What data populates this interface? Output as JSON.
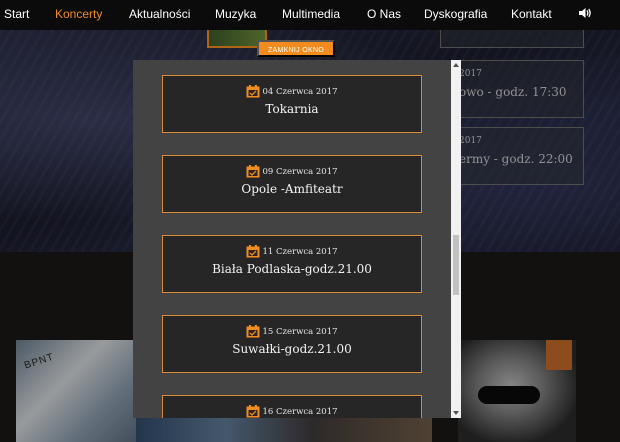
{
  "nav": {
    "items": [
      {
        "label": "Start",
        "active": false
      },
      {
        "label": "Koncerty",
        "active": true
      },
      {
        "label": "Aktualności",
        "active": false
      },
      {
        "label": "Muzyka",
        "active": false
      },
      {
        "label": "Multimedia",
        "active": false
      },
      {
        "label": "O Nas",
        "active": false
      },
      {
        "label": "Dyskografia",
        "active": false
      },
      {
        "label": "Kontakt",
        "active": false
      }
    ],
    "sound_icon": "speaker-icon"
  },
  "background": {
    "cards": [
      {
        "date": "2017",
        "text": "owo - godz. 17:30"
      },
      {
        "date": "2017",
        "text": "ermy - godz. 22:00"
      }
    ],
    "poster_text": "BPNT"
  },
  "modal": {
    "close_label": "ZAMKNIJ OKNO",
    "events": [
      {
        "date": "04 Czerwca 2017",
        "name": "Tokarnia"
      },
      {
        "date": "09 Czerwca 2017",
        "name": "Opole -Amfiteatr"
      },
      {
        "date": "11 Czerwca 2017",
        "name": "Biała Podlaska-godz.21.00"
      },
      {
        "date": "15 Czerwca 2017",
        "name": "Suwałki-godz.21.00"
      },
      {
        "date": "16 Czerwca 2017",
        "name": ""
      }
    ]
  },
  "colors": {
    "accent": "#f28c1f",
    "nav_bg": "#0b0b0c",
    "modal_bg": "#434343",
    "card_bg": "#262626",
    "card_border": "#d9883a"
  }
}
